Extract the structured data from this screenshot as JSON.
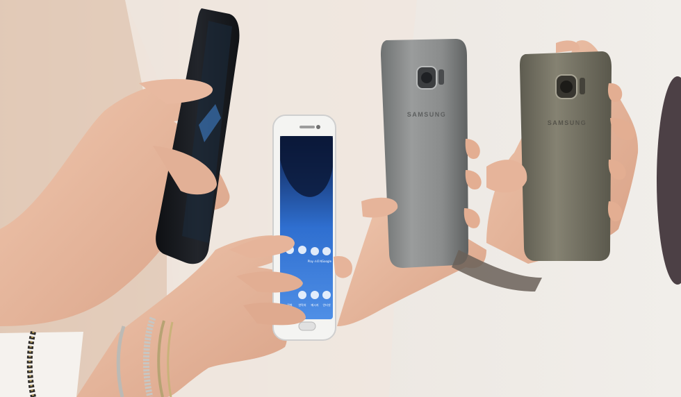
{
  "photo": {
    "phones": [
      {
        "id": "black-phone-screen",
        "finish": "black"
      },
      {
        "id": "white-phone-front",
        "finish": "white",
        "screen_apps": [
          {
            "label": "Play 스토어"
          },
          {
            "label": "Google"
          },
          {
            "label": "전화"
          },
          {
            "label": "연락처"
          },
          {
            "label": "메시지"
          },
          {
            "label": "인터넷"
          },
          {
            "label": "카메라"
          },
          {
            "label": "앱스"
          }
        ]
      },
      {
        "id": "silver-phone-back",
        "finish": "silver",
        "brand": "SAMSUNG"
      },
      {
        "id": "gold-phone-back",
        "finish": "gold",
        "brand": "SAMSUNG"
      }
    ],
    "colors": {
      "background": "#e9e6e2",
      "skin": "#e8b9a0",
      "black_phone": "#1a1c20",
      "silver_phone": "#8d8f8f",
      "gold_phone": "#7a7868",
      "screen_blue": "#2f6fd0"
    }
  }
}
